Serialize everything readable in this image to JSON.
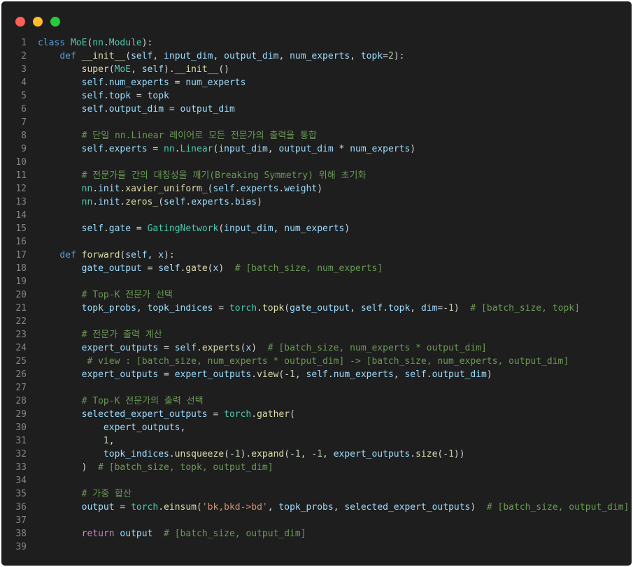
{
  "colors": {
    "background": "#1e1e1e",
    "close": "#ff5f56",
    "minimize": "#ffbd2e",
    "maximize": "#27c93f",
    "keyword": "#569cd6",
    "control": "#c586c0",
    "function": "#dcdcaa",
    "class": "#4ec9b0",
    "variable": "#9cdcfe",
    "string": "#ce9178",
    "number": "#b5cea8",
    "comment": "#6a9955",
    "text": "#d4d4d4"
  },
  "window": {
    "controls": [
      {
        "name": "close-button",
        "color": "#ff5f56"
      },
      {
        "name": "minimize-button",
        "color": "#ffbd2e"
      },
      {
        "name": "maximize-button",
        "color": "#27c93f"
      }
    ]
  },
  "lines": [
    {
      "n": "1",
      "tokens": [
        [
          "class ",
          "keyword"
        ],
        [
          "MoE",
          "class"
        ],
        [
          "(",
          "text"
        ],
        [
          "nn",
          "class"
        ],
        [
          ".",
          "text"
        ],
        [
          "Module",
          "class"
        ],
        [
          "):",
          "text"
        ]
      ]
    },
    {
      "n": "2",
      "tokens": [
        [
          "    ",
          "text"
        ],
        [
          "def ",
          "keyword"
        ],
        [
          "__init__",
          "function"
        ],
        [
          "(",
          "text"
        ],
        [
          "self",
          "variable"
        ],
        [
          ", ",
          "text"
        ],
        [
          "input_dim",
          "variable"
        ],
        [
          ", ",
          "text"
        ],
        [
          "output_dim",
          "variable"
        ],
        [
          ", ",
          "text"
        ],
        [
          "num_experts",
          "variable"
        ],
        [
          ", ",
          "text"
        ],
        [
          "topk",
          "variable"
        ],
        [
          "=",
          "text"
        ],
        [
          "2",
          "number"
        ],
        [
          "):",
          "text"
        ]
      ]
    },
    {
      "n": "3",
      "tokens": [
        [
          "        ",
          "text"
        ],
        [
          "super",
          "function"
        ],
        [
          "(",
          "text"
        ],
        [
          "MoE",
          "class"
        ],
        [
          ", ",
          "text"
        ],
        [
          "self",
          "variable"
        ],
        [
          ").",
          "text"
        ],
        [
          "__init__",
          "function"
        ],
        [
          "()",
          "text"
        ]
      ]
    },
    {
      "n": "4",
      "tokens": [
        [
          "        ",
          "text"
        ],
        [
          "self",
          "variable"
        ],
        [
          ".",
          "text"
        ],
        [
          "num_experts",
          "variable"
        ],
        [
          " = ",
          "text"
        ],
        [
          "num_experts",
          "variable"
        ]
      ]
    },
    {
      "n": "5",
      "tokens": [
        [
          "        ",
          "text"
        ],
        [
          "self",
          "variable"
        ],
        [
          ".",
          "text"
        ],
        [
          "topk",
          "variable"
        ],
        [
          " = ",
          "text"
        ],
        [
          "topk",
          "variable"
        ]
      ]
    },
    {
      "n": "6",
      "tokens": [
        [
          "        ",
          "text"
        ],
        [
          "self",
          "variable"
        ],
        [
          ".",
          "text"
        ],
        [
          "output_dim",
          "variable"
        ],
        [
          " = ",
          "text"
        ],
        [
          "output_dim",
          "variable"
        ]
      ]
    },
    {
      "n": "7",
      "tokens": []
    },
    {
      "n": "8",
      "tokens": [
        [
          "        ",
          "text"
        ],
        [
          "# 단일 nn.Linear 레이어로 모든 전문가의 출력을 통합",
          "comment"
        ]
      ]
    },
    {
      "n": "9",
      "tokens": [
        [
          "        ",
          "text"
        ],
        [
          "self",
          "variable"
        ],
        [
          ".",
          "text"
        ],
        [
          "experts",
          "variable"
        ],
        [
          " = ",
          "text"
        ],
        [
          "nn",
          "class"
        ],
        [
          ".",
          "text"
        ],
        [
          "Linear",
          "class"
        ],
        [
          "(",
          "text"
        ],
        [
          "input_dim",
          "variable"
        ],
        [
          ", ",
          "text"
        ],
        [
          "output_dim",
          "variable"
        ],
        [
          " * ",
          "text"
        ],
        [
          "num_experts",
          "variable"
        ],
        [
          ")",
          "text"
        ]
      ]
    },
    {
      "n": "10",
      "tokens": []
    },
    {
      "n": "11",
      "tokens": [
        [
          "        ",
          "text"
        ],
        [
          "# 전문가들 간의 대칭성을 깨기(Breaking Symmetry) 위해 초기화",
          "comment"
        ]
      ]
    },
    {
      "n": "12",
      "tokens": [
        [
          "        ",
          "text"
        ],
        [
          "nn",
          "class"
        ],
        [
          ".",
          "text"
        ],
        [
          "init",
          "variable"
        ],
        [
          ".",
          "text"
        ],
        [
          "xavier_uniform_",
          "function"
        ],
        [
          "(",
          "text"
        ],
        [
          "self",
          "variable"
        ],
        [
          ".",
          "text"
        ],
        [
          "experts",
          "variable"
        ],
        [
          ".",
          "text"
        ],
        [
          "weight",
          "variable"
        ],
        [
          ")",
          "text"
        ]
      ]
    },
    {
      "n": "13",
      "tokens": [
        [
          "        ",
          "text"
        ],
        [
          "nn",
          "class"
        ],
        [
          ".",
          "text"
        ],
        [
          "init",
          "variable"
        ],
        [
          ".",
          "text"
        ],
        [
          "zeros_",
          "function"
        ],
        [
          "(",
          "text"
        ],
        [
          "self",
          "variable"
        ],
        [
          ".",
          "text"
        ],
        [
          "experts",
          "variable"
        ],
        [
          ".",
          "text"
        ],
        [
          "bias",
          "variable"
        ],
        [
          ")",
          "text"
        ]
      ]
    },
    {
      "n": "14",
      "tokens": []
    },
    {
      "n": "15",
      "tokens": [
        [
          "        ",
          "text"
        ],
        [
          "self",
          "variable"
        ],
        [
          ".",
          "text"
        ],
        [
          "gate",
          "variable"
        ],
        [
          " = ",
          "text"
        ],
        [
          "GatingNetwork",
          "class"
        ],
        [
          "(",
          "text"
        ],
        [
          "input_dim",
          "variable"
        ],
        [
          ", ",
          "text"
        ],
        [
          "num_experts",
          "variable"
        ],
        [
          ")",
          "text"
        ]
      ]
    },
    {
      "n": "16",
      "tokens": []
    },
    {
      "n": "17",
      "tokens": [
        [
          "    ",
          "text"
        ],
        [
          "def ",
          "keyword"
        ],
        [
          "forward",
          "function"
        ],
        [
          "(",
          "text"
        ],
        [
          "self",
          "variable"
        ],
        [
          ", ",
          "text"
        ],
        [
          "x",
          "variable"
        ],
        [
          "):",
          "text"
        ]
      ]
    },
    {
      "n": "18",
      "tokens": [
        [
          "        ",
          "text"
        ],
        [
          "gate_output",
          "variable"
        ],
        [
          " = ",
          "text"
        ],
        [
          "self",
          "variable"
        ],
        [
          ".",
          "text"
        ],
        [
          "gate",
          "function"
        ],
        [
          "(",
          "text"
        ],
        [
          "x",
          "variable"
        ],
        [
          ")  ",
          "text"
        ],
        [
          "# [batch_size, num_experts]",
          "comment"
        ]
      ]
    },
    {
      "n": "19",
      "tokens": []
    },
    {
      "n": "20",
      "tokens": [
        [
          "        ",
          "text"
        ],
        [
          "# Top-K 전문가 선택",
          "comment"
        ]
      ]
    },
    {
      "n": "21",
      "tokens": [
        [
          "        ",
          "text"
        ],
        [
          "topk_probs",
          "variable"
        ],
        [
          ", ",
          "text"
        ],
        [
          "topk_indices",
          "variable"
        ],
        [
          " = ",
          "text"
        ],
        [
          "torch",
          "class"
        ],
        [
          ".",
          "text"
        ],
        [
          "topk",
          "function"
        ],
        [
          "(",
          "text"
        ],
        [
          "gate_output",
          "variable"
        ],
        [
          ", ",
          "text"
        ],
        [
          "self",
          "variable"
        ],
        [
          ".",
          "text"
        ],
        [
          "topk",
          "variable"
        ],
        [
          ", ",
          "text"
        ],
        [
          "dim",
          "variable"
        ],
        [
          "=-",
          "text"
        ],
        [
          "1",
          "number"
        ],
        [
          ")  ",
          "text"
        ],
        [
          "# [batch_size, topk]",
          "comment"
        ]
      ]
    },
    {
      "n": "22",
      "tokens": []
    },
    {
      "n": "23",
      "tokens": [
        [
          "        ",
          "text"
        ],
        [
          "# 전문가 출력 계산",
          "comment"
        ]
      ]
    },
    {
      "n": "24",
      "tokens": [
        [
          "        ",
          "text"
        ],
        [
          "expert_outputs",
          "variable"
        ],
        [
          " = ",
          "text"
        ],
        [
          "self",
          "variable"
        ],
        [
          ".",
          "text"
        ],
        [
          "experts",
          "function"
        ],
        [
          "(",
          "text"
        ],
        [
          "x",
          "variable"
        ],
        [
          ")  ",
          "text"
        ],
        [
          "# [batch_size, num_experts * output_dim]",
          "comment"
        ]
      ]
    },
    {
      "n": "25",
      "tokens": [
        [
          "         ",
          "text"
        ],
        [
          "# view : [batch_size, num_experts * output_dim] -> [batch_size, num_experts, output_dim]",
          "comment"
        ]
      ]
    },
    {
      "n": "26",
      "tokens": [
        [
          "        ",
          "text"
        ],
        [
          "expert_outputs",
          "variable"
        ],
        [
          " = ",
          "text"
        ],
        [
          "expert_outputs",
          "variable"
        ],
        [
          ".",
          "text"
        ],
        [
          "view",
          "function"
        ],
        [
          "(-",
          "text"
        ],
        [
          "1",
          "number"
        ],
        [
          ", ",
          "text"
        ],
        [
          "self",
          "variable"
        ],
        [
          ".",
          "text"
        ],
        [
          "num_experts",
          "variable"
        ],
        [
          ", ",
          "text"
        ],
        [
          "self",
          "variable"
        ],
        [
          ".",
          "text"
        ],
        [
          "output_dim",
          "variable"
        ],
        [
          ")",
          "text"
        ]
      ]
    },
    {
      "n": "27",
      "tokens": []
    },
    {
      "n": "28",
      "tokens": [
        [
          "        ",
          "text"
        ],
        [
          "# Top-K 전문가의 출력 선택",
          "comment"
        ]
      ]
    },
    {
      "n": "29",
      "tokens": [
        [
          "        ",
          "text"
        ],
        [
          "selected_expert_outputs",
          "variable"
        ],
        [
          " = ",
          "text"
        ],
        [
          "torch",
          "class"
        ],
        [
          ".",
          "text"
        ],
        [
          "gather",
          "function"
        ],
        [
          "(",
          "text"
        ]
      ]
    },
    {
      "n": "30",
      "tokens": [
        [
          "            ",
          "text"
        ],
        [
          "expert_outputs",
          "variable"
        ],
        [
          ",",
          "text"
        ]
      ]
    },
    {
      "n": "31",
      "tokens": [
        [
          "            ",
          "text"
        ],
        [
          "1",
          "number"
        ],
        [
          ",",
          "text"
        ]
      ]
    },
    {
      "n": "32",
      "tokens": [
        [
          "            ",
          "text"
        ],
        [
          "topk_indices",
          "variable"
        ],
        [
          ".",
          "text"
        ],
        [
          "unsqueeze",
          "function"
        ],
        [
          "(-",
          "text"
        ],
        [
          "1",
          "number"
        ],
        [
          ").",
          "text"
        ],
        [
          "expand",
          "function"
        ],
        [
          "(-",
          "text"
        ],
        [
          "1",
          "number"
        ],
        [
          ", -",
          "text"
        ],
        [
          "1",
          "number"
        ],
        [
          ", ",
          "text"
        ],
        [
          "expert_outputs",
          "variable"
        ],
        [
          ".",
          "text"
        ],
        [
          "size",
          "function"
        ],
        [
          "(-",
          "text"
        ],
        [
          "1",
          "number"
        ],
        [
          "))",
          "text"
        ]
      ]
    },
    {
      "n": "33",
      "tokens": [
        [
          "        ",
          "text"
        ],
        [
          ")  ",
          "text"
        ],
        [
          "# [batch_size, topk, output_dim]",
          "comment"
        ]
      ]
    },
    {
      "n": "34",
      "tokens": []
    },
    {
      "n": "35",
      "tokens": [
        [
          "        ",
          "text"
        ],
        [
          "# 가중 합산",
          "comment"
        ]
      ]
    },
    {
      "n": "36",
      "tokens": [
        [
          "        ",
          "text"
        ],
        [
          "output",
          "variable"
        ],
        [
          " = ",
          "text"
        ],
        [
          "torch",
          "class"
        ],
        [
          ".",
          "text"
        ],
        [
          "einsum",
          "function"
        ],
        [
          "(",
          "text"
        ],
        [
          "'bk,bkd->bd'",
          "string"
        ],
        [
          ", ",
          "text"
        ],
        [
          "topk_probs",
          "variable"
        ],
        [
          ", ",
          "text"
        ],
        [
          "selected_expert_outputs",
          "variable"
        ],
        [
          ")  ",
          "text"
        ],
        [
          "# [batch_size, output_dim]",
          "comment"
        ]
      ]
    },
    {
      "n": "37",
      "tokens": []
    },
    {
      "n": "38",
      "tokens": [
        [
          "        ",
          "text"
        ],
        [
          "return ",
          "control"
        ],
        [
          "output",
          "variable"
        ],
        [
          "  ",
          "text"
        ],
        [
          "# [batch_size, output_dim]",
          "comment"
        ]
      ]
    },
    {
      "n": "39",
      "tokens": []
    }
  ]
}
